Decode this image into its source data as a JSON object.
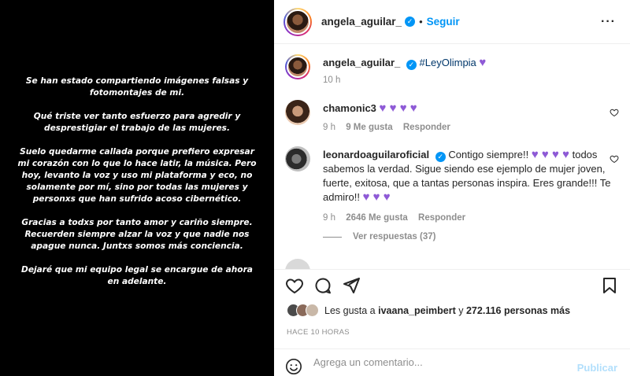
{
  "post": {
    "paragraphs": [
      "Se han estado compartiendo imágenes falsas y fotomontajes de mi.",
      "Qué triste ver tanto esfuerzo para agredir y desprestigiar el trabajo de las mujeres.",
      "Suelo quedarme callada porque prefiero expresar mi corazón con lo que lo hace latir, la música. Pero hoy, levanto la voz y uso mi plataforma y eco, no solamente por mí, sino por todas las mujeres y personxs que han sufrido acoso cibernético.",
      "Gracias a todxs por tanto amor y cariño siempre. Recuerden siempre alzar la voz y que nadie nos apague nunca. Juntxs somos más conciencia.",
      "Dejaré que mi equipo legal se encargue de ahora en adelante."
    ]
  },
  "header": {
    "username": "angela_aguilar_",
    "separator": "•",
    "follow_label": "Seguir",
    "more": "···"
  },
  "caption": {
    "username": "angela_aguilar_",
    "hashtag": "#LeyOlimpia",
    "emoji": "♥",
    "time": "10 h"
  },
  "comments": [
    {
      "username": "chamonic3",
      "text": "♥ ♥ ♥ ♥",
      "time": "9 h",
      "likes": "9 Me gusta",
      "reply": "Responder"
    },
    {
      "username": "leonardoaguilaroficial",
      "text_before": "Contigo siempre!! ",
      "hearts1": "♥ ♥ ♥ ♥",
      "text_mid": " todos sabemos la verdad. Sigue siendo ese ejemplo de mujer joven, fuerte, exitosa, que a tantas personas inspira. Eres grande!!! Te admiro!! ",
      "hearts2": "♥ ♥ ♥",
      "time": "9 h",
      "likes": "2646 Me gusta",
      "reply": "Responder"
    }
  ],
  "view_replies": "Ver respuestas (37)",
  "likes": {
    "prefix": "Les gusta a ",
    "user": "ivaana_peimbert",
    "middle": " y ",
    "count": "272.116 personas más"
  },
  "time_ago": "HACE 10 HORAS",
  "comment_bar": {
    "placeholder": "Agrega un comentario...",
    "publish": "Publicar"
  },
  "colors": {
    "accent": "#0095f6",
    "heart_purple": "#8e5ad6",
    "muted": "#8e8e8e"
  }
}
